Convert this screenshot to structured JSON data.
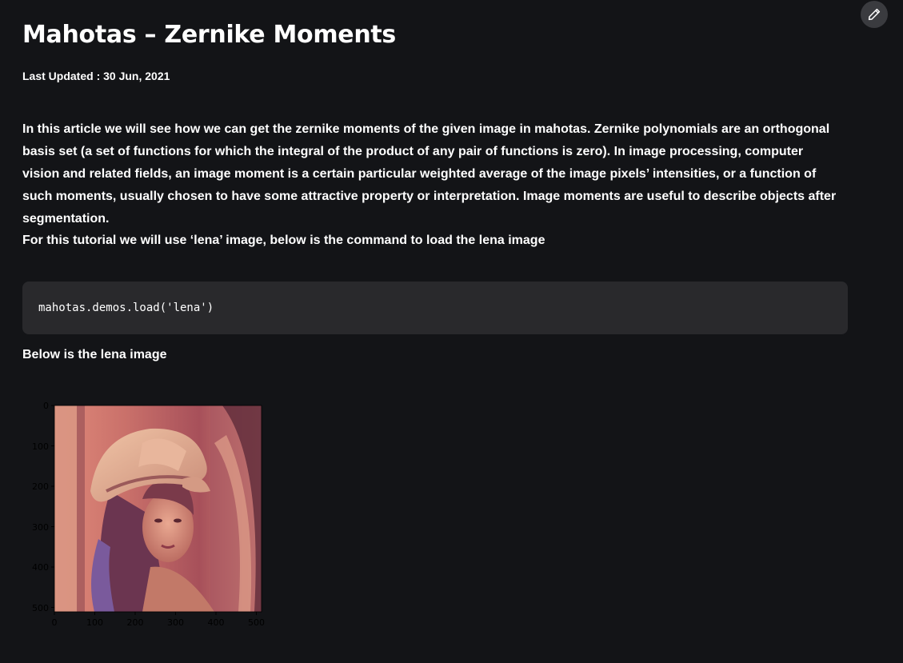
{
  "article": {
    "title": "Mahotas – Zernike Moments",
    "last_updated": "Last Updated : 30 Jun, 2021",
    "intro": "In this article we will see how we can get the zernike moments of the given image in mahotas. Zernike polynomials are an orthogonal basis set (a set of functions for which the integral of the product of any pair of functions is zero). In image processing, computer vision and related fields, an image moment is a certain particular weighted average of the image pixels’ intensities, or a function of such moments, usually chosen to have some attractive property or interpretation. Image moments are useful to describe objects after segmentation.",
    "intro2": "For this tutorial we will use ‘lena’ image, below is the command to load the lena image",
    "code": "mahotas.demos.load('lena')",
    "caption": "Below is the lena image"
  },
  "icons": {
    "edit": "pencil-icon"
  },
  "figure": {
    "y_ticks": [
      "0",
      "100",
      "200",
      "300",
      "400",
      "500"
    ],
    "x_ticks": [
      "0",
      "100",
      "200",
      "300",
      "400",
      "500"
    ],
    "image": "lena-photo"
  }
}
